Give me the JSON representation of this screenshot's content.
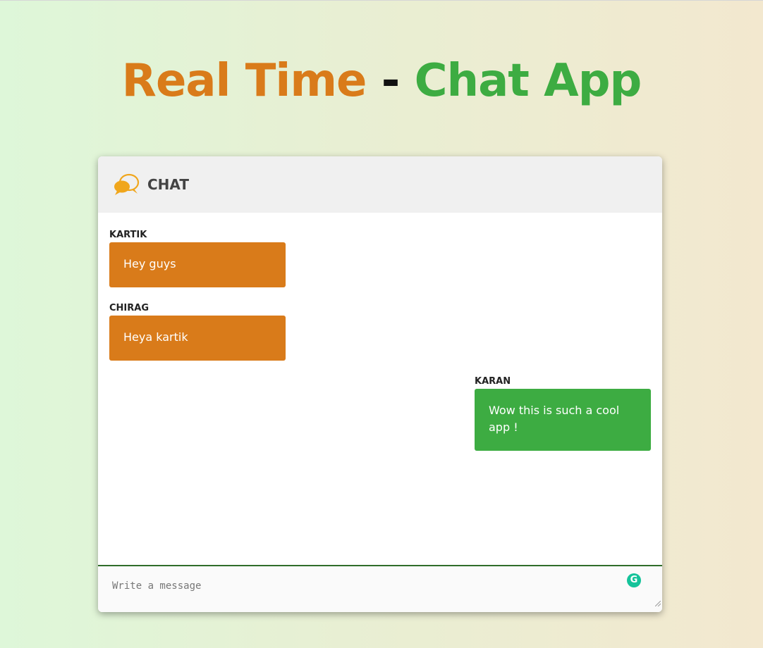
{
  "page": {
    "title_part1": "Real Time",
    "title_separator": " - ",
    "title_part2": "Chat App"
  },
  "chat": {
    "header_label": "CHAT",
    "header_icon": "chat-bubbles-icon",
    "messages": [
      {
        "sender": "KARTIK",
        "text": "Hey guys",
        "direction": "incoming"
      },
      {
        "sender": "CHIRAG",
        "text": "Heya kartik",
        "direction": "incoming"
      },
      {
        "sender": "KARAN",
        "text": "Wow this is such a cool app !",
        "direction": "outgoing"
      }
    ],
    "composer": {
      "placeholder": "Write a message",
      "value": "",
      "extension_icon": "grammarly-icon",
      "extension_glyph": "G"
    }
  },
  "colors": {
    "incoming_bubble": "#d97b1a",
    "outgoing_bubble": "#3dac42",
    "title_orange": "#d97b1a",
    "title_green": "#3dac42",
    "icon_orange": "#f0a61c"
  }
}
